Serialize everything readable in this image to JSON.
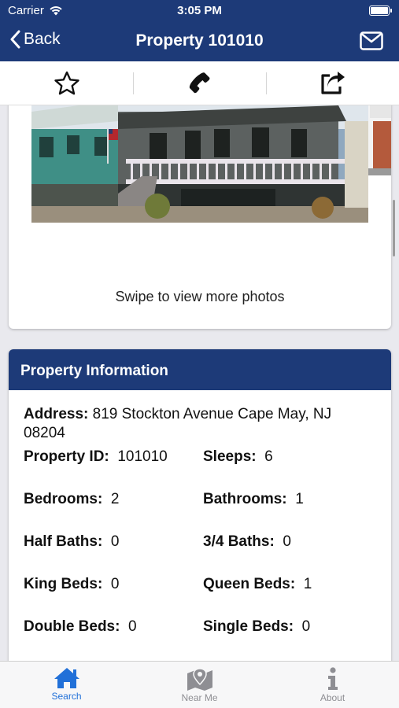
{
  "status_bar": {
    "carrier": "Carrier",
    "time": "3:05 PM"
  },
  "nav": {
    "back_label": "Back",
    "title": "Property 101010"
  },
  "toolbar": {
    "items": [
      "star-icon",
      "phone-icon",
      "share-icon"
    ]
  },
  "photos": {
    "swipe_hint": "Swipe to view more photos"
  },
  "info": {
    "header": "Property Information",
    "address_label": "Address:",
    "address_value": "819 Stockton Avenue Cape May, NJ 08204",
    "fields": [
      {
        "label": "Property ID:",
        "value": "101010"
      },
      {
        "label": "Sleeps:",
        "value": "6"
      },
      {
        "label": "Bedrooms:",
        "value": "2"
      },
      {
        "label": "Bathrooms:",
        "value": "1"
      },
      {
        "label": "Half Baths:",
        "value": "0"
      },
      {
        "label": "3/4 Baths:",
        "value": "0"
      },
      {
        "label": "King Beds:",
        "value": "0"
      },
      {
        "label": "Queen Beds:",
        "value": "1"
      },
      {
        "label": "Double Beds:",
        "value": "0"
      },
      {
        "label": "Single Beds:",
        "value": "0"
      }
    ]
  },
  "tabs": [
    {
      "label": "Search",
      "icon": "home-icon",
      "active": true
    },
    {
      "label": "Near Me",
      "icon": "map-pin-icon",
      "active": false
    },
    {
      "label": "About",
      "icon": "info-icon",
      "active": false
    }
  ],
  "colors": {
    "brand": "#1d3a78",
    "active_tab": "#2170d8",
    "inactive_tab": "#8e8e93"
  }
}
